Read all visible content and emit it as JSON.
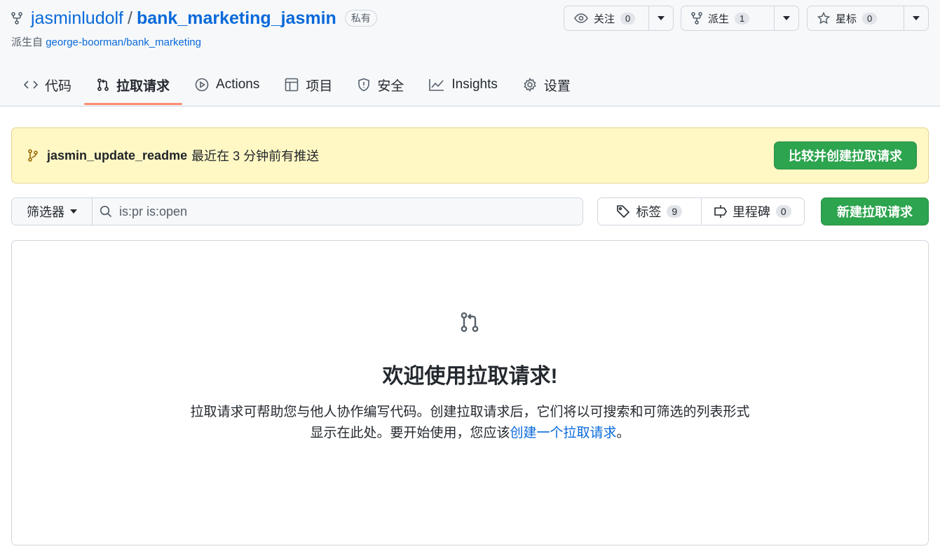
{
  "repo": {
    "owner": "jasminludolf",
    "separator": "/",
    "name": "bank_marketing_jasmin",
    "visibility": "私有",
    "forked_prefix": "派生自",
    "forked_from": "george-boorman/bank_marketing"
  },
  "actions": {
    "watch": {
      "label": "关注",
      "count": "0",
      "icon": "eye-icon"
    },
    "fork": {
      "label": "派生",
      "count": "1",
      "icon": "fork-icon"
    },
    "star": {
      "label": "星标",
      "count": "0",
      "icon": "star-icon"
    }
  },
  "tabs": [
    {
      "label": "代码",
      "icon": "code-icon"
    },
    {
      "label": "拉取请求",
      "icon": "pull-request-icon",
      "selected": true
    },
    {
      "label": "Actions",
      "icon": "play-icon"
    },
    {
      "label": "项目",
      "icon": "table-icon"
    },
    {
      "label": "安全",
      "icon": "shield-icon"
    },
    {
      "label": "Insights",
      "icon": "graph-icon"
    },
    {
      "label": "设置",
      "icon": "gear-icon"
    }
  ],
  "banner": {
    "branch": "jasmin_update_readme",
    "pushed_text": "最近在 3 分钟前有推送",
    "button": "比较并创建拉取请求"
  },
  "filters": {
    "filter_label": "筛选器",
    "search_value": "is:pr is:open",
    "labels_label": "标签",
    "labels_count": "9",
    "milestones_label": "里程碑",
    "milestones_count": "0",
    "new_pr_button": "新建拉取请求"
  },
  "blankslate": {
    "title": "欢迎使用拉取请求!",
    "line1": "拉取请求可帮助您与他人协作编写代码。创建拉取请求后，它们将以可搜索和可筛选的列表形式",
    "line2_prefix": "显示在此处。要开始使用，您应该",
    "line2_link": "创建一个拉取请求",
    "line2_suffix": "。"
  },
  "colors": {
    "link": "#0969da",
    "primary_button": "#2da44e",
    "banner_bg": "#fff8c5",
    "tab_underline": "#fd8c73"
  }
}
